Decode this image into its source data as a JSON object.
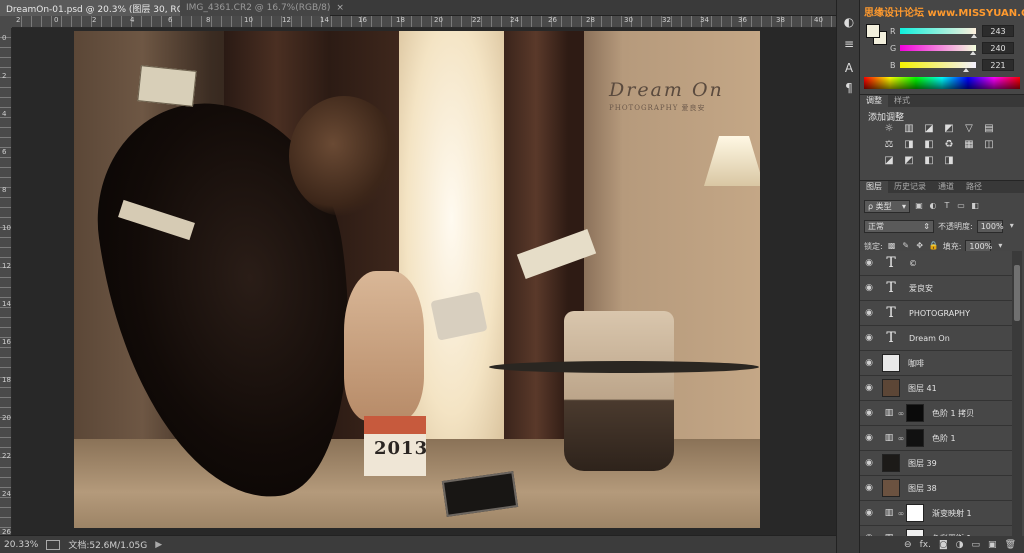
{
  "tabs": [
    {
      "label": "DreamOn-01.psd @ 20.3% (图层 30, RGB/8) *",
      "close": "×"
    },
    {
      "label": "IMG_4361.CR2 @ 16.7%(RGB/8)",
      "close": "×"
    }
  ],
  "ruler": {
    "top_numbers": [
      "2",
      "0",
      "2",
      "4",
      "6",
      "8",
      "10",
      "12",
      "14",
      "16",
      "18",
      "20",
      "22",
      "24",
      "26",
      "28",
      "30",
      "32",
      "34",
      "36",
      "38",
      "40"
    ],
    "left_numbers": [
      "0",
      "2",
      "4",
      "6",
      "8",
      "10",
      "12",
      "14",
      "16",
      "18",
      "20",
      "22",
      "24",
      "26"
    ]
  },
  "artwork": {
    "title": "Dream On",
    "subtitle": "PHOTOGRAPHY 爱良安",
    "year": "2013"
  },
  "status": {
    "zoom": "20.33%",
    "doc": "文档:52.6M/1.05G",
    "arrow": "▶"
  },
  "color_panel": {
    "watermark": "思缘设计论坛 www.MISSYUAN.COM",
    "r_label": "R",
    "r_value": "243",
    "g_label": "G",
    "g_value": "240",
    "b_label": "B",
    "b_value": "221",
    "colors": {
      "r": "#f30000",
      "g": "#00f000",
      "b": "#0000dd"
    }
  },
  "adjustments": {
    "tabs": [
      "调整",
      "样式"
    ],
    "title": "添加调整",
    "icons": [
      "☼",
      "▥",
      "◪",
      "◩",
      "▽",
      "▤",
      "⚖",
      "◨",
      "◧",
      "♻",
      "▦",
      "◫",
      "◪",
      "◩",
      "◧",
      "◨"
    ]
  },
  "layers_panel": {
    "tabs": [
      "图层",
      "历史记录",
      "通道",
      "路径"
    ],
    "filter_label": "ρ 类型",
    "filter_icons": [
      "▣",
      "◐",
      "T",
      "▭",
      "◧"
    ],
    "blend_mode": "正常",
    "opacity_label": "不透明度:",
    "opacity_value": "100%",
    "lock_label": "锁定:",
    "lock_icons": [
      "▩",
      "✎",
      "✥",
      "🔒"
    ],
    "fill_label": "填充:",
    "fill_value": "100%",
    "footer_icons": [
      "⊖",
      "fx.",
      "◙",
      "◑",
      "▭",
      "▣",
      "🗑"
    ],
    "layers": [
      {
        "name": "©",
        "kind": "text"
      },
      {
        "name": "爱良安",
        "kind": "text"
      },
      {
        "name": "PHOTOGRAPHY",
        "kind": "text"
      },
      {
        "name": "Dream On",
        "kind": "text"
      },
      {
        "name": "咖啡",
        "kind": "image",
        "thumb": "#e8e8e8"
      },
      {
        "name": "图层 41",
        "kind": "image",
        "thumb": "#5c4636"
      },
      {
        "name": "色阶 1 拷贝",
        "kind": "adjust",
        "mask": "#0a0a0a"
      },
      {
        "name": "色阶 1",
        "kind": "adjust",
        "mask": "#111111"
      },
      {
        "name": "图层 39",
        "kind": "image",
        "thumb": "#1c1a18"
      },
      {
        "name": "图层 38",
        "kind": "image",
        "thumb": "#6b5240"
      },
      {
        "name": "渐变映射 1",
        "kind": "adjust",
        "mask": "#ffffff"
      },
      {
        "name": "色彩平衡 1",
        "kind": "adjust",
        "mask": "#f0f0f0"
      }
    ]
  }
}
